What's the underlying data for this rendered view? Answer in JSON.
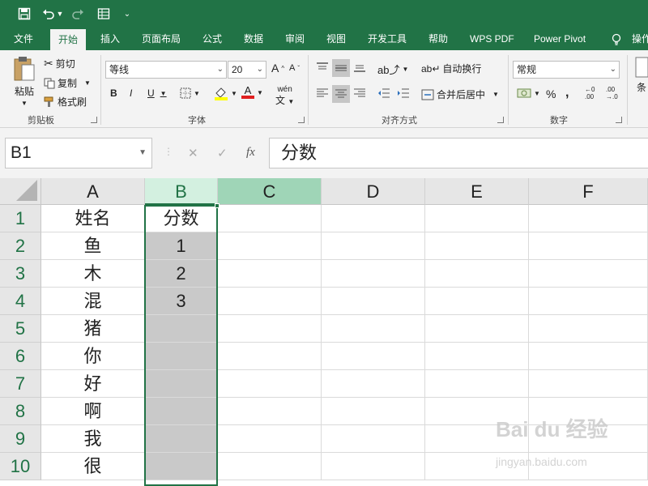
{
  "qat": {
    "save_icon": "save-icon",
    "undo_icon": "undo-icon",
    "redo_icon": "redo-icon",
    "form_icon": "form-icon",
    "customize_icon": "chevron-down-icon"
  },
  "tabs": [
    {
      "label": "文件"
    },
    {
      "label": "开始"
    },
    {
      "label": "插入"
    },
    {
      "label": "页面布局"
    },
    {
      "label": "公式"
    },
    {
      "label": "数据"
    },
    {
      "label": "审阅"
    },
    {
      "label": "视图"
    },
    {
      "label": "开发工具"
    },
    {
      "label": "帮助"
    },
    {
      "label": "WPS PDF"
    },
    {
      "label": "Power Pivot"
    },
    {
      "label": "操作"
    }
  ],
  "ribbon": {
    "clipboard": {
      "paste": "粘贴",
      "cut": "剪切",
      "copy": "复制",
      "format_painter": "格式刷",
      "group_label": "剪贴板"
    },
    "font": {
      "font_name": "等线",
      "font_size": "20",
      "bold": "B",
      "italic": "I",
      "underline": "U",
      "grow": "A",
      "shrink": "A",
      "font_color_letter": "A",
      "phonetic": "wén",
      "group_label": "字体"
    },
    "alignment": {
      "wrap_text": "自动换行",
      "merge_center": "合并后居中",
      "group_label": "对齐方式"
    },
    "number": {
      "format": "常规",
      "percent": "%",
      "comma": ",",
      "group_label": "数字"
    },
    "styles": {
      "conditional": "条"
    }
  },
  "formula_bar": {
    "name_box": "B1",
    "cancel": "✕",
    "enter": "✓",
    "fx": "fx",
    "formula": "分数"
  },
  "grid": {
    "columns": [
      "A",
      "B",
      "C",
      "D",
      "E",
      "F"
    ],
    "rows": [
      "1",
      "2",
      "3",
      "4",
      "5",
      "6",
      "7",
      "8",
      "9",
      "10"
    ],
    "col_a": [
      "姓名",
      "鱼",
      "木",
      "混",
      "猪",
      "你",
      "好",
      "啊",
      "我",
      "很"
    ],
    "col_b": [
      "分数",
      "1",
      "2",
      "3",
      "",
      "",
      "",
      "",
      "",
      ""
    ],
    "selected_cell": "B1",
    "colors": {
      "accent": "#217346",
      "selected_fill": "#c9c9c9",
      "header_highlight": "#9fd5b7"
    }
  },
  "watermark": {
    "text": "Bai du 经验",
    "url": "jingyan.baidu.com"
  }
}
